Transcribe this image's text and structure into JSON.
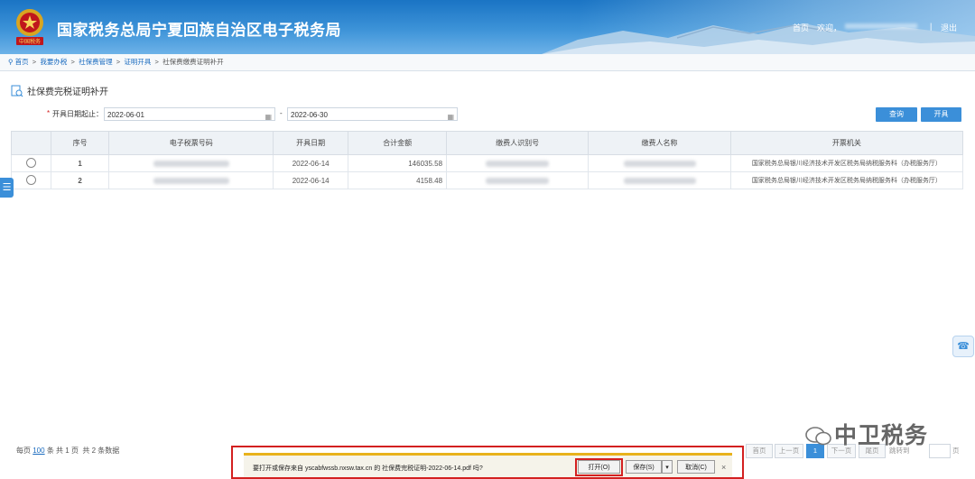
{
  "header": {
    "site_title": "国家税务总局宁夏回族自治区电子税务局",
    "home": "首页",
    "welcome": "欢迎，",
    "separator": "|",
    "logout": "退出"
  },
  "breadcrumb": [
    "首页",
    "我要办税",
    "社保费管理",
    "证明开具",
    "社保费缴费证明补开"
  ],
  "page": {
    "heading": "社保费完税证明补开",
    "date_label": "开具日期起止：",
    "required_mark": "*",
    "date_from": "2022-06-01",
    "date_to": "2022-06-30",
    "dash": "-",
    "query_button": "查询",
    "issue_button": "开具"
  },
  "table": {
    "columns": [
      "序号",
      "电子税票号码",
      "开具日期",
      "合计金额",
      "缴费人识别号",
      "缴费人名称",
      "开票机关"
    ],
    "rows": [
      {
        "no": "1",
        "date": "2022-06-14",
        "amount": "146035.58",
        "office": "国家税务总局银川经济技术开发区税务局纳税服务科（办税服务厅）"
      },
      {
        "no": "2",
        "date": "2022-06-14",
        "amount": "4158.48",
        "office": "国家税务总局银川经济技术开发区税务局纳税服务科（办税服务厅）"
      }
    ]
  },
  "footer": {
    "per_page_label": "每页",
    "per_page_value": "100",
    "per_page_suffix": "条 共 1 页",
    "total": "共 2 条数据",
    "pager": [
      "首页",
      "上一页",
      "1",
      "下一页",
      "尾页",
      "跳转到",
      "页"
    ]
  },
  "download_bar": {
    "message": "要打开或保存来自 yscabfwssb.nxsw.tax.cn 的 社保费完税证明-2022-06-14.pdf 吗?",
    "open": "打开(O)",
    "save": "保存(S)",
    "dropdown": "▾",
    "cancel": "取消(C)",
    "close": "×"
  },
  "watermark": "中卫税务",
  "side_tab_glyph": "☰",
  "float_glyph": "☎",
  "emblem_text": "中国税务",
  "colors": {
    "header_blue": "#1a74c4",
    "button_blue": "#3b8fd9",
    "highlight_red": "#d32020",
    "link_blue": "#1a6bbf"
  }
}
